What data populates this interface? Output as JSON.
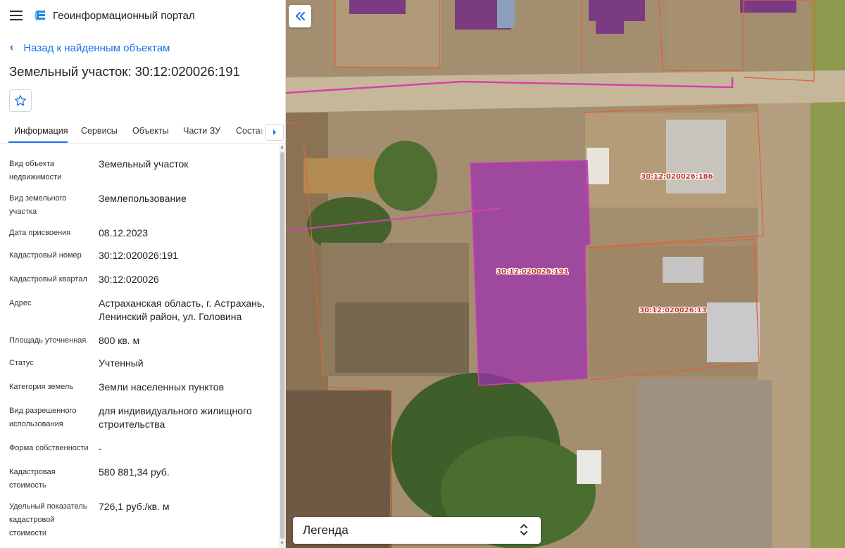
{
  "header": {
    "app_title": "Геоинформационный портал"
  },
  "back_link": "Назад к найденным объектам",
  "page_title": "Земельный участок: 30:12:020026:191",
  "tabs": [
    "Информация",
    "Сервисы",
    "Объекты",
    "Части ЗУ",
    "Состав"
  ],
  "properties": [
    {
      "key": "Вид объекта недвижимости",
      "value": "Земельный участок"
    },
    {
      "key": "Вид земельного участка",
      "value": "Землепользование"
    },
    {
      "key": "Дата присвоения",
      "value": "08.12.2023"
    },
    {
      "key": "Кадастровый номер",
      "value": "30:12:020026:191"
    },
    {
      "key": "Кадастровый квартал",
      "value": "30:12:020026"
    },
    {
      "key": "Адрес",
      "value": "Астраханская область, г. Астрахань, Ленинский район, ул. Головина"
    },
    {
      "key": "Площадь уточненная",
      "value": "800 кв. м"
    },
    {
      "key": "Статус",
      "value": "Учтенный"
    },
    {
      "key": "Категория земель",
      "value": "Земли населенных пунктов"
    },
    {
      "key": "Вид разрешенного использования",
      "value": "для индивидуального жилищного строительства"
    },
    {
      "key": "Форма собственности",
      "value": "-"
    },
    {
      "key": "Кадастровая стоимость",
      "value": "580 881,34 руб."
    },
    {
      "key": "Удельный показатель кадастровой стоимости",
      "value": "726,1 руб./кв. м"
    }
  ],
  "map": {
    "parcel_labels": [
      "30:12:020026:186",
      "30:12:020026:191",
      "30:12:020026:13"
    ],
    "legend_label": "Легенда"
  },
  "icons": {
    "menu": "menu-icon",
    "logo": "portal-logo-icon",
    "back": "chevron-left-icon",
    "favorite": "star-icon",
    "tabs_scroll": "chevron-right-icon",
    "collapse": "double-chevron-left-icon",
    "legend_toggle": "chevron-up-down-icon"
  },
  "colors": {
    "accent": "#1a73e8",
    "selected_parcel_fill": "#9b2fae",
    "parcel_border": "#e0603a",
    "boundary_line": "#d63fb0"
  }
}
